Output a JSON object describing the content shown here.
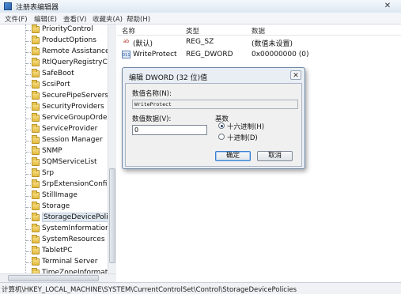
{
  "window": {
    "title": "注册表编辑器",
    "close_glyph": "✕"
  },
  "menu": {
    "items": [
      {
        "label": "文件(F)"
      },
      {
        "label": "编辑(E)"
      },
      {
        "label": "查看(V)"
      },
      {
        "label": "收藏夹(A)"
      },
      {
        "label": "帮助(H)"
      }
    ]
  },
  "tree": {
    "items": [
      {
        "label": "PriorityControl"
      },
      {
        "label": "ProductOptions"
      },
      {
        "label": "Remote Assistance"
      },
      {
        "label": "RtlQueryRegistryConf"
      },
      {
        "label": "SafeBoot"
      },
      {
        "label": "ScsiPort"
      },
      {
        "label": "SecurePipeServers"
      },
      {
        "label": "SecurityProviders"
      },
      {
        "label": "ServiceGroupOrder"
      },
      {
        "label": "ServiceProvider"
      },
      {
        "label": "Session Manager"
      },
      {
        "label": "SNMP"
      },
      {
        "label": "SQMServiceList"
      },
      {
        "label": "Srp"
      },
      {
        "label": "SrpExtensionConfig"
      },
      {
        "label": "StillImage"
      },
      {
        "label": "Storage"
      },
      {
        "label": "StorageDevicePolicies"
      },
      {
        "label": "SystemInformation"
      },
      {
        "label": "SystemResources"
      },
      {
        "label": "TabletPC"
      },
      {
        "label": "Terminal Server"
      },
      {
        "label": "TimeZoneInformation"
      }
    ]
  },
  "list": {
    "headers": {
      "name": "名称",
      "type": "类型",
      "data": "数据"
    },
    "rows": [
      {
        "icon": "ab",
        "name": "(默认)",
        "type": "REG_SZ",
        "data": "(数值未设置)"
      },
      {
        "icon": "011",
        "name": "WriteProtect",
        "type": "REG_DWORD",
        "data": "0x00000000 (0)"
      }
    ]
  },
  "dialog": {
    "title": "编辑 DWORD (32 位)值",
    "close_glyph": "✕",
    "name_label": "数值名称(N):",
    "name_value": "WriteProtect",
    "data_label": "数值数据(V):",
    "data_value": "0",
    "base_label": "基数",
    "hex_label": "十六进制(H)",
    "dec_label": "十进制(D)",
    "ok_label": "确定",
    "cancel_label": "取消"
  },
  "status": {
    "path": "计算机\\HKEY_LOCAL_MACHINE\\SYSTEM\\CurrentControlSet\\Control\\StorageDevicePolicies"
  }
}
